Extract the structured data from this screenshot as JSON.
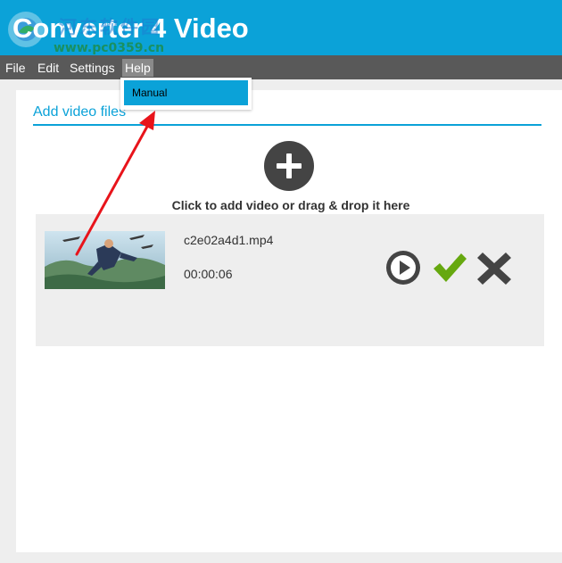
{
  "app": {
    "title": "Converter 4 Video",
    "watermark_cn": "河东软件园",
    "watermark_url": "www.pc0359.cn"
  },
  "menu": {
    "file": "File",
    "edit": "Edit",
    "settings": "Settings",
    "help": "Help"
  },
  "help_menu": {
    "manual": "Manual"
  },
  "main": {
    "section_title": "Add video files",
    "add_hint": "Click to add video or drag & drop it here"
  },
  "video": {
    "file_name": "c2e02a4d1.mp4",
    "duration": "00:00:06"
  },
  "colors": {
    "accent": "#0ba2d8",
    "menubar": "#595959",
    "confirm_green": "#66a80f",
    "icon_dark": "#444444",
    "annotation_arrow": "#e8141b"
  },
  "icons": {
    "add": "plus-circle-icon",
    "play": "play-circle-icon",
    "confirm": "checkmark-icon",
    "remove": "x-icon"
  }
}
